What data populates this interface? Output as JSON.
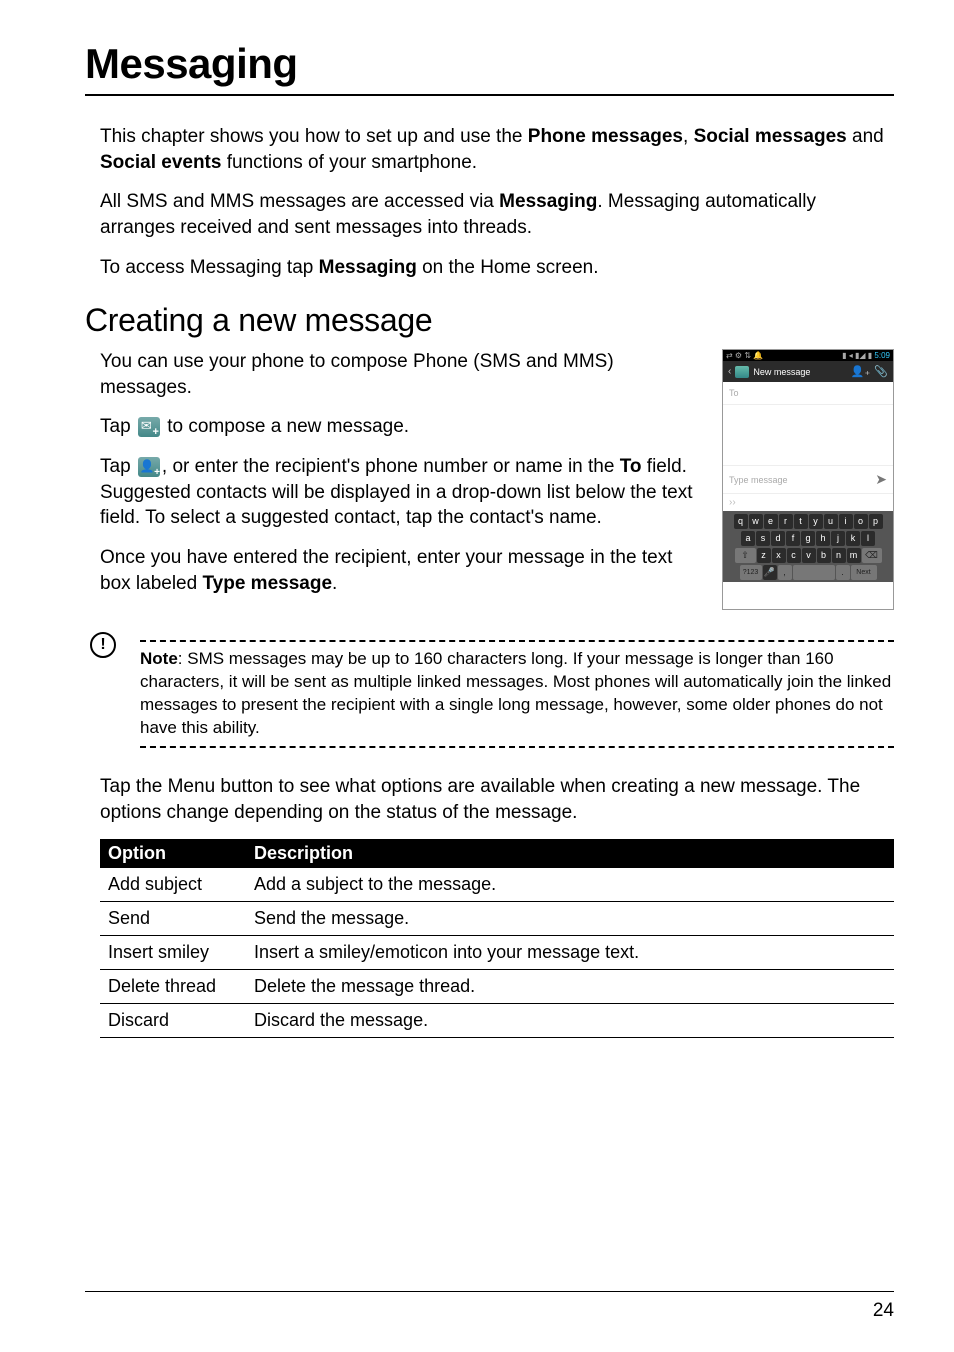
{
  "page": {
    "title": "Messaging",
    "intro1_a": "This chapter shows you how to set up and use the ",
    "intro1_b": "Phone messages",
    "intro1_c": ", ",
    "intro1_d": "Social messages",
    "intro1_e": " and ",
    "intro1_f": "Social events",
    "intro1_g": " functions of your smartphone.",
    "intro2_a": "All SMS and MMS messages are accessed via ",
    "intro2_b": "Messaging",
    "intro2_c": ". Messaging automatically arranges received and sent messages into threads.",
    "intro3_a": "To access Messaging tap ",
    "intro3_b": "Messaging",
    "intro3_c": " on the Home screen.",
    "section_title": "Creating a new message",
    "create1": "You can use your phone to compose Phone (SMS and MMS) messages.",
    "create2_a": "Tap ",
    "create2_b": " to compose a new message.",
    "create3_a": "Tap ",
    "create3_b": ", or enter the recipient's phone number or name in the ",
    "create3_c": "To",
    "create3_d": " field. Suggested contacts will be displayed in a drop-down list below the text field. To select a suggested contact, tap the contact's name.",
    "create4_a": "Once you have entered the recipient, enter your message in the text box labeled ",
    "create4_b": "Type message",
    "create4_c": ".",
    "note_label": "Note",
    "note_text": ": SMS messages may be up to 160 characters long. If your message is longer than 160 characters, it will be sent as multiple linked messages. Most phones will automatically join the linked messages to present the recipient with a single long message, however, some older phones do not have this ability.",
    "menu_text": "Tap the Menu button to see what options are available when creating a new message. The options change depending on the status of the message.",
    "table": {
      "h1": "Option",
      "h2": "Description",
      "rows": [
        {
          "opt": "Add subject",
          "desc": "Add a subject to the message."
        },
        {
          "opt": "Send",
          "desc": "Send the message."
        },
        {
          "opt": "Insert smiley",
          "desc": "Insert a smiley/emoticon into your message text."
        },
        {
          "opt": "Delete thread",
          "desc": "Delete the message thread."
        },
        {
          "opt": "Discard",
          "desc": "Discard the message."
        }
      ]
    },
    "page_number": "24"
  },
  "phone": {
    "status_left": "⇄ ⚙ ⇅ 🔔",
    "status_signal": "▮ ◂ ▮◢ ▮",
    "time": "5:09",
    "header_title": "New message",
    "to_placeholder": "To",
    "type_placeholder": "Type message",
    "hint": "››",
    "keys_row1": [
      "q",
      "w",
      "e",
      "r",
      "t",
      "y",
      "u",
      "i",
      "o",
      "p"
    ],
    "keys_row2": [
      "a",
      "s",
      "d",
      "f",
      "g",
      "h",
      "j",
      "k",
      "l"
    ],
    "keys_row3_shift": "⇧",
    "keys_row3": [
      "z",
      "x",
      "c",
      "v",
      "b",
      "n",
      "m"
    ],
    "keys_row3_bksp": "⌫",
    "keys_row4_num": "?123",
    "keys_row4_mic": "🎤",
    "keys_row4_comma": ",",
    "keys_row4_space": " ",
    "keys_row4_dot": ".",
    "keys_row4_next": "Next"
  }
}
